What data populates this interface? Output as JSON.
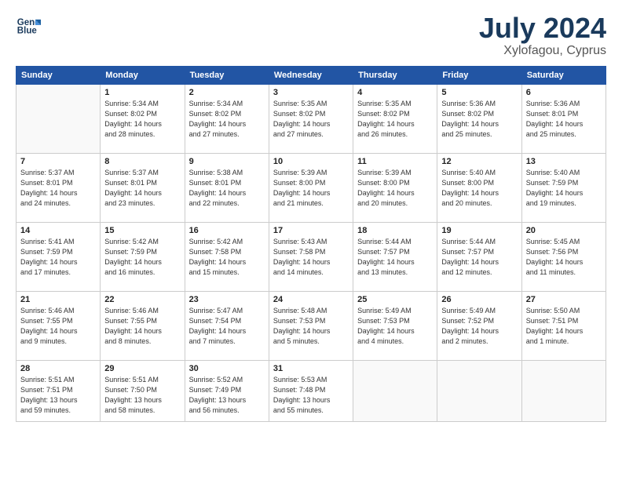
{
  "logo": {
    "line1": "General",
    "line2": "Blue"
  },
  "title": "July 2024",
  "subtitle": "Xylofagou, Cyprus",
  "weekdays": [
    "Sunday",
    "Monday",
    "Tuesday",
    "Wednesday",
    "Thursday",
    "Friday",
    "Saturday"
  ],
  "weeks": [
    [
      {
        "day": "",
        "info": ""
      },
      {
        "day": "1",
        "info": "Sunrise: 5:34 AM\nSunset: 8:02 PM\nDaylight: 14 hours\nand 28 minutes."
      },
      {
        "day": "2",
        "info": "Sunrise: 5:34 AM\nSunset: 8:02 PM\nDaylight: 14 hours\nand 27 minutes."
      },
      {
        "day": "3",
        "info": "Sunrise: 5:35 AM\nSunset: 8:02 PM\nDaylight: 14 hours\nand 27 minutes."
      },
      {
        "day": "4",
        "info": "Sunrise: 5:35 AM\nSunset: 8:02 PM\nDaylight: 14 hours\nand 26 minutes."
      },
      {
        "day": "5",
        "info": "Sunrise: 5:36 AM\nSunset: 8:02 PM\nDaylight: 14 hours\nand 25 minutes."
      },
      {
        "day": "6",
        "info": "Sunrise: 5:36 AM\nSunset: 8:01 PM\nDaylight: 14 hours\nand 25 minutes."
      }
    ],
    [
      {
        "day": "7",
        "info": "Sunrise: 5:37 AM\nSunset: 8:01 PM\nDaylight: 14 hours\nand 24 minutes."
      },
      {
        "day": "8",
        "info": "Sunrise: 5:37 AM\nSunset: 8:01 PM\nDaylight: 14 hours\nand 23 minutes."
      },
      {
        "day": "9",
        "info": "Sunrise: 5:38 AM\nSunset: 8:01 PM\nDaylight: 14 hours\nand 22 minutes."
      },
      {
        "day": "10",
        "info": "Sunrise: 5:39 AM\nSunset: 8:00 PM\nDaylight: 14 hours\nand 21 minutes."
      },
      {
        "day": "11",
        "info": "Sunrise: 5:39 AM\nSunset: 8:00 PM\nDaylight: 14 hours\nand 20 minutes."
      },
      {
        "day": "12",
        "info": "Sunrise: 5:40 AM\nSunset: 8:00 PM\nDaylight: 14 hours\nand 20 minutes."
      },
      {
        "day": "13",
        "info": "Sunrise: 5:40 AM\nSunset: 7:59 PM\nDaylight: 14 hours\nand 19 minutes."
      }
    ],
    [
      {
        "day": "14",
        "info": "Sunrise: 5:41 AM\nSunset: 7:59 PM\nDaylight: 14 hours\nand 17 minutes."
      },
      {
        "day": "15",
        "info": "Sunrise: 5:42 AM\nSunset: 7:59 PM\nDaylight: 14 hours\nand 16 minutes."
      },
      {
        "day": "16",
        "info": "Sunrise: 5:42 AM\nSunset: 7:58 PM\nDaylight: 14 hours\nand 15 minutes."
      },
      {
        "day": "17",
        "info": "Sunrise: 5:43 AM\nSunset: 7:58 PM\nDaylight: 14 hours\nand 14 minutes."
      },
      {
        "day": "18",
        "info": "Sunrise: 5:44 AM\nSunset: 7:57 PM\nDaylight: 14 hours\nand 13 minutes."
      },
      {
        "day": "19",
        "info": "Sunrise: 5:44 AM\nSunset: 7:57 PM\nDaylight: 14 hours\nand 12 minutes."
      },
      {
        "day": "20",
        "info": "Sunrise: 5:45 AM\nSunset: 7:56 PM\nDaylight: 14 hours\nand 11 minutes."
      }
    ],
    [
      {
        "day": "21",
        "info": "Sunrise: 5:46 AM\nSunset: 7:55 PM\nDaylight: 14 hours\nand 9 minutes."
      },
      {
        "day": "22",
        "info": "Sunrise: 5:46 AM\nSunset: 7:55 PM\nDaylight: 14 hours\nand 8 minutes."
      },
      {
        "day": "23",
        "info": "Sunrise: 5:47 AM\nSunset: 7:54 PM\nDaylight: 14 hours\nand 7 minutes."
      },
      {
        "day": "24",
        "info": "Sunrise: 5:48 AM\nSunset: 7:53 PM\nDaylight: 14 hours\nand 5 minutes."
      },
      {
        "day": "25",
        "info": "Sunrise: 5:49 AM\nSunset: 7:53 PM\nDaylight: 14 hours\nand 4 minutes."
      },
      {
        "day": "26",
        "info": "Sunrise: 5:49 AM\nSunset: 7:52 PM\nDaylight: 14 hours\nand 2 minutes."
      },
      {
        "day": "27",
        "info": "Sunrise: 5:50 AM\nSunset: 7:51 PM\nDaylight: 14 hours\nand 1 minute."
      }
    ],
    [
      {
        "day": "28",
        "info": "Sunrise: 5:51 AM\nSunset: 7:51 PM\nDaylight: 13 hours\nand 59 minutes."
      },
      {
        "day": "29",
        "info": "Sunrise: 5:51 AM\nSunset: 7:50 PM\nDaylight: 13 hours\nand 58 minutes."
      },
      {
        "day": "30",
        "info": "Sunrise: 5:52 AM\nSunset: 7:49 PM\nDaylight: 13 hours\nand 56 minutes."
      },
      {
        "day": "31",
        "info": "Sunrise: 5:53 AM\nSunset: 7:48 PM\nDaylight: 13 hours\nand 55 minutes."
      },
      {
        "day": "",
        "info": ""
      },
      {
        "day": "",
        "info": ""
      },
      {
        "day": "",
        "info": ""
      }
    ]
  ]
}
